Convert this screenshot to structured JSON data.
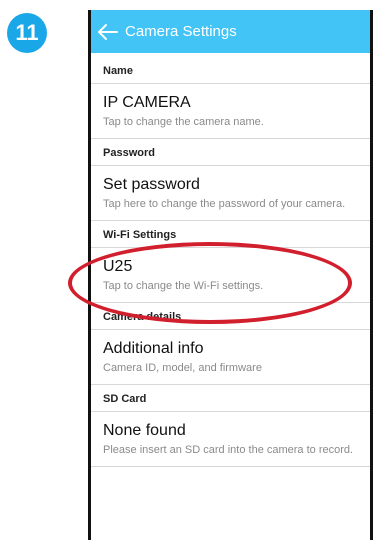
{
  "step": {
    "number": "11"
  },
  "appbar": {
    "title": "Camera Settings",
    "back_icon": "arrow-left-icon"
  },
  "sections": {
    "name": {
      "header": "Name",
      "title": "IP CAMERA",
      "subtitle": "Tap to change the camera name."
    },
    "password": {
      "header": "Password",
      "title": "Set password",
      "subtitle": "Tap here to change the password of your camera."
    },
    "wifi": {
      "header": "Wi-Fi Settings",
      "title": "U25",
      "subtitle": "Tap to change the Wi-Fi settings."
    },
    "camera_details": {
      "header": "Camera details",
      "title": "Additional info",
      "subtitle": "Camera ID, model, and firmware"
    },
    "sd_card": {
      "header": "SD Card",
      "title": "None found",
      "subtitle": "Please insert an SD card into the camera to record."
    }
  },
  "colors": {
    "appbar": "#42c4f6",
    "badge": "#1aa7e8",
    "highlight": "#d21f2d"
  }
}
